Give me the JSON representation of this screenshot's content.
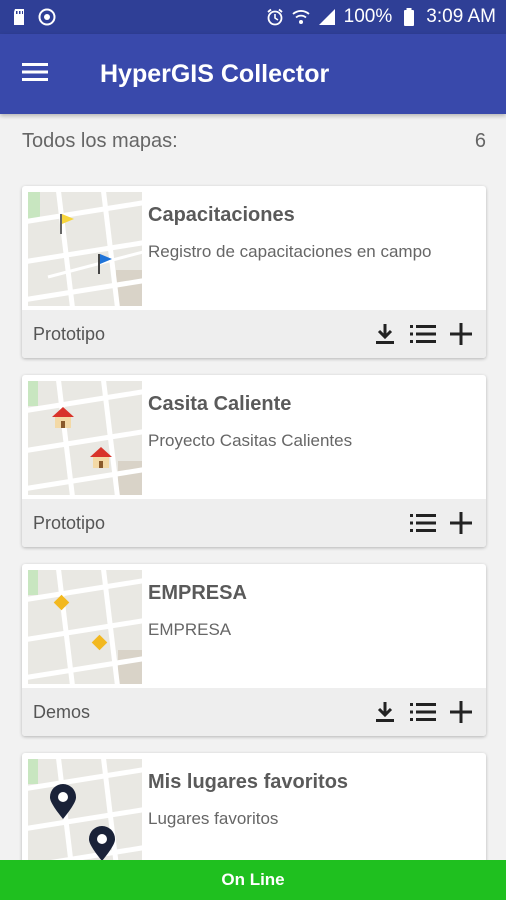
{
  "status_bar": {
    "battery_percent": "100%",
    "time": "3:09 AM",
    "icons": [
      "sd-card-icon",
      "target-icon",
      "alarm-icon",
      "wifi-icon",
      "signal-icon",
      "battery-icon"
    ]
  },
  "app_bar": {
    "title": "HyperGIS Collector",
    "menu_icon": "menu-icon"
  },
  "list_header": {
    "label": "Todos los mapas:",
    "count": "6"
  },
  "maps": [
    {
      "title": "Capacitaciones",
      "description": "Registro de capacitaciones en campo",
      "category": "Prototipo",
      "actions": [
        "download-icon",
        "list-icon",
        "add-icon"
      ],
      "marker_type": "flags"
    },
    {
      "title": "Casita Caliente",
      "description": "Proyecto Casitas Calientes",
      "category": "Prototipo",
      "actions": [
        "list-icon",
        "add-icon"
      ],
      "marker_type": "houses"
    },
    {
      "title": "EMPRESA",
      "description": "EMPRESA",
      "category": "Demos",
      "actions": [
        "download-icon",
        "list-icon",
        "add-icon"
      ],
      "marker_type": "diamonds"
    },
    {
      "title": "Mis lugares favoritos",
      "description": "Lugares favoritos",
      "category": "",
      "actions": [],
      "marker_type": "pins"
    }
  ],
  "connection": {
    "label": "On Line",
    "color": "#1fc01f"
  },
  "colors": {
    "primary": "#3949ab",
    "primary_dark": "#2f3f96"
  }
}
